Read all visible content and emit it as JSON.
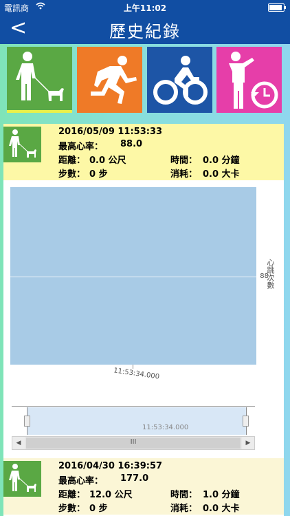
{
  "status": {
    "carrier": "電訊商",
    "wifi": "wifi",
    "time": "上午11:02",
    "battery_level": 0.9
  },
  "nav": {
    "back": "<",
    "title": "歷史紀錄"
  },
  "tiles": [
    {
      "name": "walk-dog",
      "color": "#5aa844",
      "selected": true
    },
    {
      "name": "run",
      "color": "#ef7a27",
      "selected": false
    },
    {
      "name": "bike",
      "color": "#1d55a6",
      "selected": false
    },
    {
      "name": "history",
      "color": "#e63ea9",
      "selected": false
    }
  ],
  "records": [
    {
      "datetime": "2016/05/09 11:53:33",
      "max_hr_label": "最高心率：",
      "max_hr": "88.0",
      "distance_label": "距離：",
      "distance": "0.0 公尺",
      "time_label": "時間：",
      "time": "0.0 分鐘",
      "steps_label": "步數：",
      "steps": "0 步",
      "burn_label": "消耗：",
      "burn": "0.0 大卡"
    },
    {
      "datetime": "2016/04/30 16:39:57",
      "max_hr_label": "最高心率：",
      "max_hr": "177.0",
      "distance_label": "距離：",
      "distance": "12.0 公尺",
      "time_label": "時間：",
      "time": "1.0 分鐘",
      "steps_label": "步數：",
      "steps": "0 步",
      "burn_label": "消耗：",
      "burn": "0.0 大卡"
    }
  ],
  "chart_data": {
    "type": "area",
    "x": [
      "11:53:34.000"
    ],
    "series": [
      {
        "values": [
          88
        ]
      }
    ],
    "ylabel": "心跳次數",
    "y_tick_labels": [
      "88"
    ],
    "x_tick_labels": [
      "11:53:34.000"
    ],
    "navigator_label": "11:53:34.000",
    "scrollbar_grip": "III",
    "scroll_left": "◀",
    "scroll_right": "▶"
  }
}
